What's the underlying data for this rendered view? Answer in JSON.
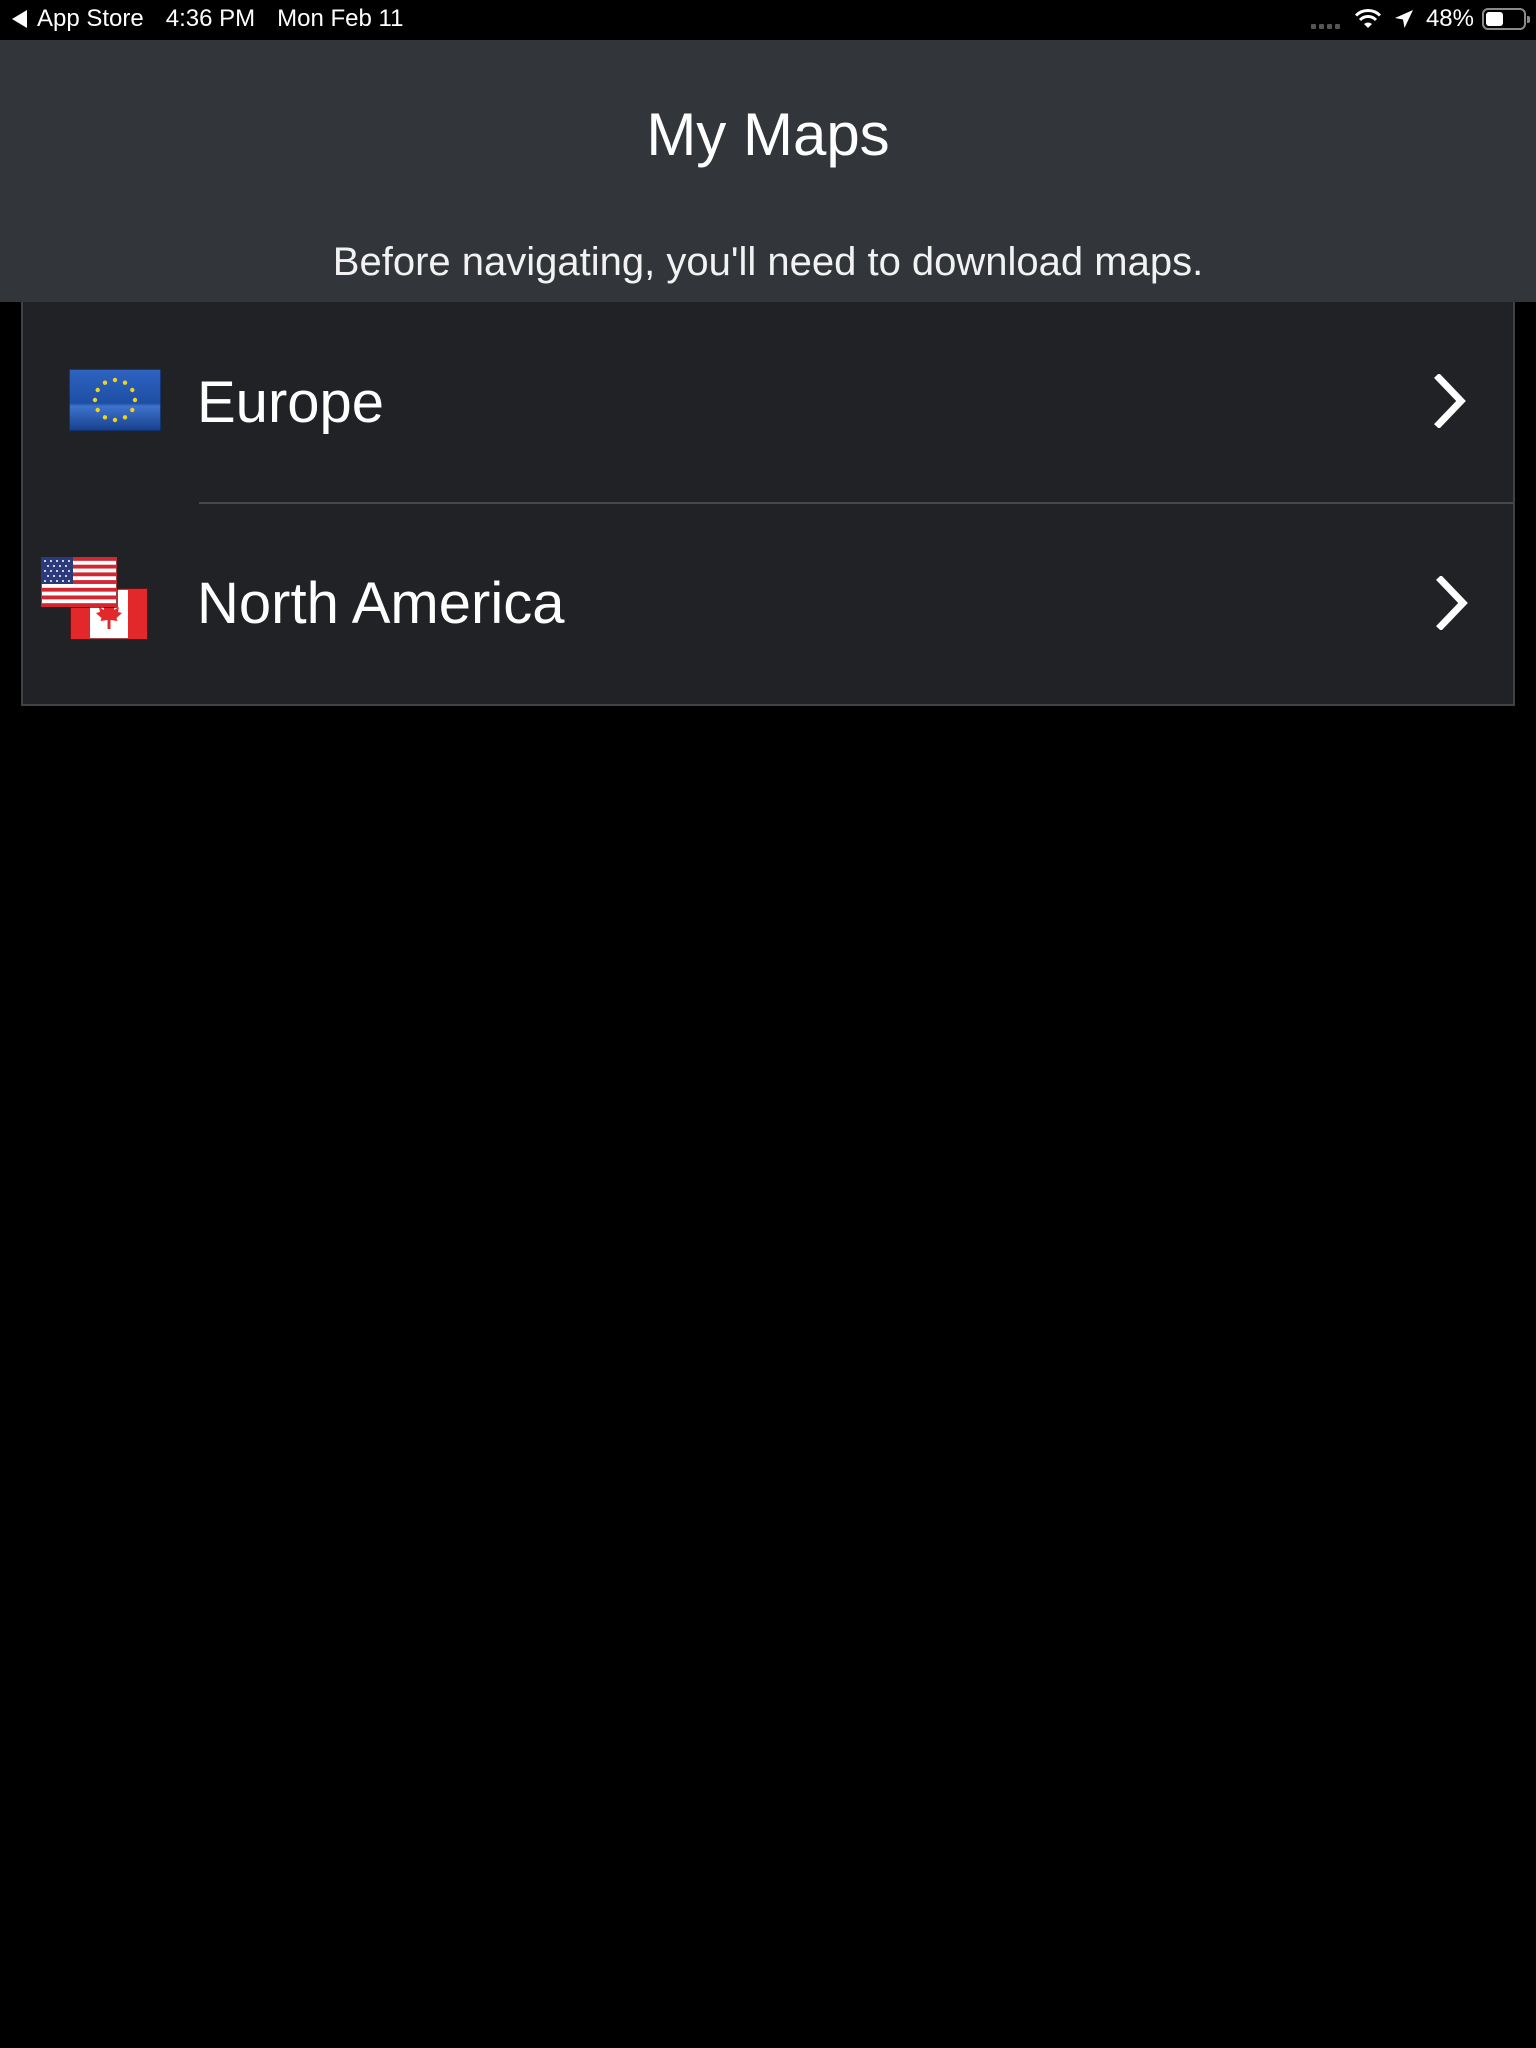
{
  "status_bar": {
    "back_label": "App Store",
    "time": "4:36 PM",
    "date": "Mon Feb 11",
    "battery": "48%",
    "battery_level": 0.48,
    "icons": [
      "back-triangle-icon",
      "signal-dots-icon",
      "wifi-icon",
      "location-arrow-icon",
      "battery-icon"
    ]
  },
  "header": {
    "title": "My Maps",
    "subtitle": "Before navigating, you'll need to download maps."
  },
  "regions": [
    {
      "label": "Europe",
      "flag_icon": "eu-flag-icon"
    },
    {
      "label": "North America",
      "flag_icon": "us-canada-flags-icon"
    }
  ],
  "colors": {
    "header_bg": "#32363a",
    "list_bg": "#212225",
    "page_bg": "#000000",
    "eu_blue": "#1f4fa6",
    "eu_star": "#f2d21b",
    "flag_red": "#e3282b"
  }
}
